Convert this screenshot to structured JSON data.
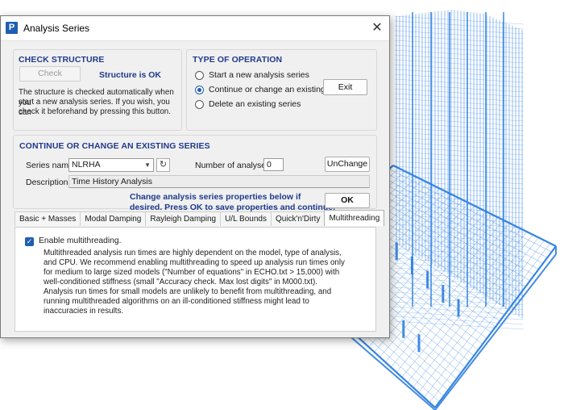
{
  "window": {
    "title": "Analysis Series",
    "logo_letter": "P",
    "close_glyph": "✕"
  },
  "check_structure": {
    "heading": "CHECK STRUCTURE",
    "check_button": "Check",
    "status": "Structure is OK",
    "description_lines": [
      "The structure is checked automatically when you",
      "start a new analysis series. If you wish, you can",
      "check it beforehand by pressing this button."
    ]
  },
  "type_of_operation": {
    "heading": "TYPE OF OPERATION",
    "options": [
      {
        "label": "Start a new analysis series",
        "checked": false
      },
      {
        "label": "Continue or change an existing series",
        "checked": true
      },
      {
        "label": "Delete an existing series",
        "checked": false
      }
    ],
    "exit_button": "Exit"
  },
  "continue_series": {
    "heading": "CONTINUE OR CHANGE AN EXISTING SERIES",
    "series_name_label": "Series name",
    "series_name_value": "NLRHA",
    "number_of_analyses_label": "Number of analyses =",
    "number_of_analyses_value": "0",
    "unchange_button": "UnChange",
    "description_label": "Description",
    "description_value": "Time History Analysis",
    "info_lines": [
      "Change analysis series properties below if",
      "desired. Press OK to save properties and continue."
    ],
    "ok_button": "OK"
  },
  "tabs": [
    {
      "label": "Basic + Masses",
      "active": false
    },
    {
      "label": "Modal  Damping",
      "active": false
    },
    {
      "label": "Rayleigh Damping",
      "active": false
    },
    {
      "label": "U/L Bounds",
      "active": false
    },
    {
      "label": "Quick'n'Dirty",
      "active": false
    },
    {
      "label": "Multithreading",
      "active": true
    }
  ],
  "multithreading": {
    "checkbox_label": "Enable multithreading.",
    "checked": true,
    "body_lines": [
      "Multithreaded analysis run times are highly dependent on the model, type of analysis,",
      "and CPU. We recommend enabling multithreading to speed up analysis run times only",
      "for medium to large sized models (\"Number of equations\" in ECHO.txt > 15,000) with",
      "well-conditioned stiffness (small \"Accuracy check. Max lost digits\" in M000.txt).",
      "Analysis run times for small models are unlikely to benefit from multithreading, and",
      "running multithreaded algorithms on an ill-conditioned stiffness might lead to",
      "inaccuracies in results."
    ]
  },
  "colors": {
    "accent": "#1f5fb0",
    "heading": "#1f3b8c",
    "wireframe": "#2d7fe0"
  }
}
